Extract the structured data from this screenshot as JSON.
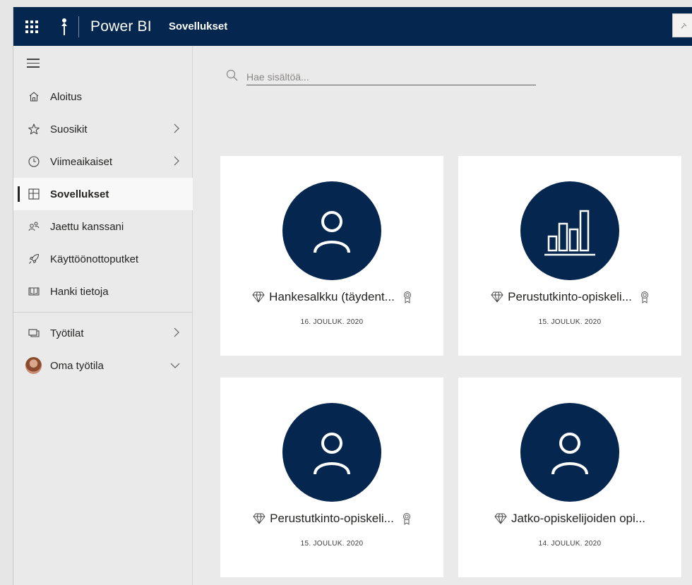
{
  "header": {
    "app_name": "Power BI",
    "breadcrumb": "Sovellukset"
  },
  "sidebar": {
    "items": [
      {
        "label": "Aloitus",
        "icon": "home-icon"
      },
      {
        "label": "Suosikit",
        "icon": "star-icon"
      },
      {
        "label": "Viimeaikaiset",
        "icon": "clock-icon"
      },
      {
        "label": "Sovellukset",
        "icon": "apps-icon",
        "active": true
      },
      {
        "label": "Jaettu kanssani",
        "icon": "shared-icon"
      },
      {
        "label": "Käyttöönottoputket",
        "icon": "rocket-icon"
      },
      {
        "label": "Hanki tietoja",
        "icon": "book-icon"
      }
    ],
    "workspaces": [
      {
        "label": "Työtilat",
        "icon": "workspaces-icon"
      },
      {
        "label": "Oma työtila",
        "icon": "avatar"
      }
    ]
  },
  "search": {
    "placeholder": "Hae sisältöä..."
  },
  "apps": [
    {
      "title": "Hankesalkku (täydent...",
      "date": "16. JOULUK. 2020",
      "icon": "person-icon",
      "certified": true
    },
    {
      "title": "Perustutkinto-opiskeli...",
      "date": "15. JOULUK. 2020",
      "icon": "bar-chart-icon",
      "certified": true
    },
    {
      "title": "Perustutkinto-opiskeli...",
      "date": "15. JOULUK. 2020",
      "icon": "person-icon",
      "certified": true
    },
    {
      "title": "Jatko-opiskelijoiden opi...",
      "date": "14. JOULUK. 2020",
      "icon": "person-icon",
      "certified": false
    }
  ],
  "colors": {
    "header_bg": "#04264f",
    "app_circle": "#04264f",
    "page_bg": "#eaeaea",
    "card_bg": "#ffffff"
  }
}
